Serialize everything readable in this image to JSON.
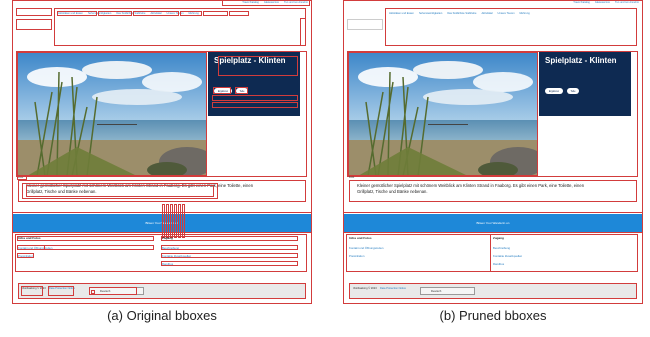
{
  "panels": [
    {
      "caption": "(a) Original bboxes",
      "top_links": [
        "Travel Katalog",
        "Gästeservice",
        "Tun und tun Annehm"
      ],
      "menu": [
        "Aktivitäten und Essen",
        "Sehenswürdigkeiten",
        "Das Südlichste Südtriebe",
        "Aktivitätal",
        "Unsere Touren",
        "Mehrung"
      ],
      "title": "Spielplatz - Klinten",
      "buttons": [
        "Ergänzen",
        "Teile"
      ],
      "photo_label": "Foto",
      "description": "Kleiner gemütlicher Spielplatz mit schönem Weitblick am Klinten Strand in Faaborg. Es gibt einen Park, eine Toilette, einen Grillplatz, Tische und Bänke nebenan.",
      "cta": "Bitsen Your Wanderin on",
      "left_section_title": "Infos und Fotos",
      "left_links": [
        "Kontakt und Öffnungszeiten",
        "Preisinfation"
      ],
      "right_section_title": "Zugang",
      "right_links": [
        "Beschreibung",
        "Kontakte Zusatzquellen",
        "Randbus"
      ],
      "footer_year": "VisitFaaborg © 2023",
      "footer_link": "Data Protection Notice",
      "language": "Deutsch"
    },
    {
      "caption": "(b) Pruned bboxes",
      "top_links": [
        "Travel Katalog",
        "Gästeservice",
        "Tun und tun Annehm"
      ],
      "menu": [
        "Aktivitäten und Essen",
        "Sehenswürdigkeiten",
        "Das Südlichste Südtriebe",
        "Aktivitätal",
        "Unsere Touren",
        "Mehrung"
      ],
      "title": "Spielplatz - Klinten",
      "buttons": [
        "Ergänzen",
        "Teile"
      ],
      "photo_label": "Foto",
      "description": "Kleiner gemütlicher Spielplatz mit schönem Weitblick am Klinten Strand in Faaborg. Es gibt einen Park, eine Toilette, einen Grillplatz, Tische und Bänke nebenan.",
      "cta": "Bitsen Your Wanderin on",
      "left_section_title": "Infos und Fotos",
      "left_links": [
        "Kontakt und Öffnungszeiten",
        "Preisinfation"
      ],
      "right_section_title": "Zugang",
      "right_links": [
        "Beschreibung",
        "Kontakte Zusatzquellen",
        "Randbus"
      ],
      "footer_year": "VisitFaaborg © 2023",
      "footer_link": "Data Protection Notice",
      "language": "Deutsch"
    }
  ],
  "colors": {
    "bbox": "#d23c3c",
    "title_bg": "#0e2a52",
    "cta_bar": "#1e88d8",
    "link": "#2a7fc1"
  }
}
